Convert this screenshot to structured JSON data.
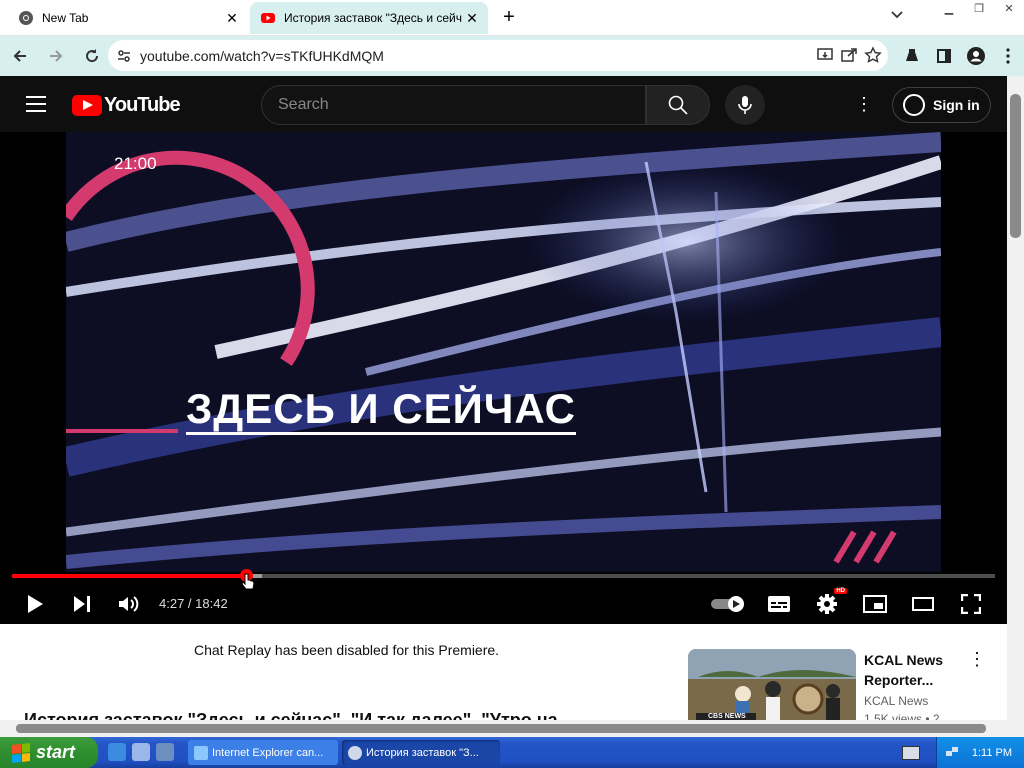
{
  "browser": {
    "tabs": [
      {
        "title": "New Tab",
        "active": false
      },
      {
        "title": "История заставок \"Здесь и сейчас\"",
        "active": true
      }
    ],
    "new_tab_symbol": "+",
    "close_symbol": "✕",
    "url": "youtube.com/watch?v=sTKfUHKdMQM",
    "accent": "#d8efef"
  },
  "youtube": {
    "logo_text": "YouTube",
    "search_placeholder": "Search",
    "signin_label": "Sign in",
    "player": {
      "overlay_clock": "21:00",
      "overlay_title": "ЗДЕСЬ И СЕЙЧАС",
      "time_display": "4:27 / 18:42",
      "progress_played_fraction": 0.238,
      "progress_buffered_fraction": 0.254,
      "hd_badge": "HD",
      "progress_color": "#ff0000"
    },
    "chat_message": "Chat Replay has been disabled for this Premiere.",
    "video_heading": "История заставок \"Здесь и сейчас\", \"И так далее\", \"Утро на",
    "recommendation": {
      "title": "KCAL News Reporter...",
      "channel": "KCAL News",
      "meta": "1.5K views • 2",
      "thumb_caption": "CBS NEWS"
    }
  },
  "taskbar": {
    "start_label": "start",
    "buttons": [
      {
        "label": "Internet Explorer can..."
      },
      {
        "label": "История заставок \"З..."
      }
    ],
    "clock": "1:11 PM"
  }
}
